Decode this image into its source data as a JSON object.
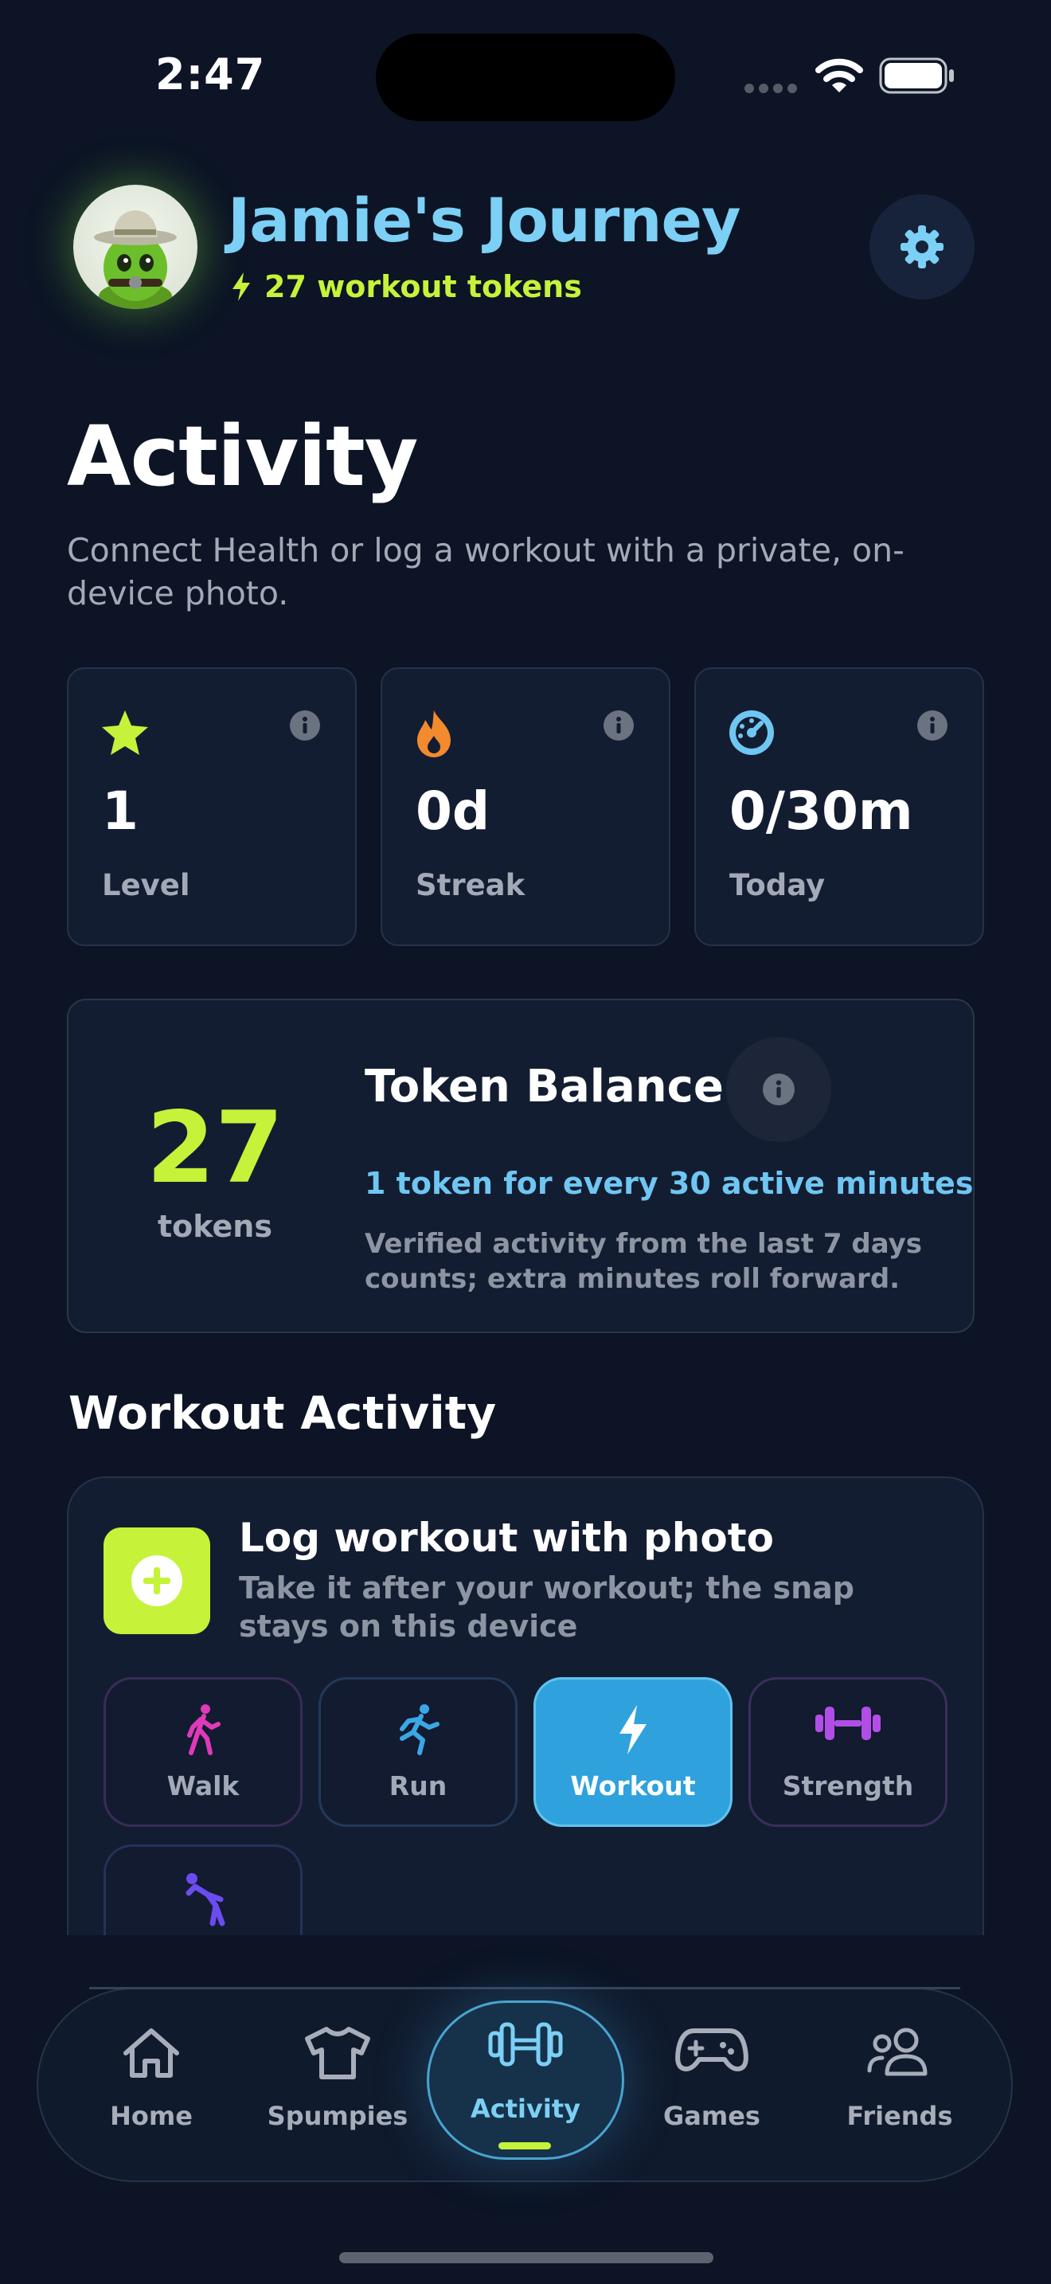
{
  "status_bar": {
    "time": "2:47"
  },
  "header": {
    "title": "Jamie's Journey",
    "tokens_label": "27 workout tokens"
  },
  "page": {
    "title": "Activity",
    "subtitle": "Connect Health or log a workout with a private, on-device photo."
  },
  "stats": [
    {
      "icon": "star-icon",
      "value": "1",
      "label": "Level",
      "color": "#c6f23a"
    },
    {
      "icon": "flame-icon",
      "value": "0d",
      "label": "Streak",
      "color": "#f28a2e"
    },
    {
      "icon": "gauge-icon",
      "value": "0/30m",
      "label": "Today",
      "color": "#6fc6f2"
    }
  ],
  "token_balance": {
    "count": "27",
    "unit": "tokens",
    "title": "Token Balance",
    "rate": "1 token for every 30 active minutes",
    "description": "Verified activity from the last 7 days counts; extra minutes roll forward."
  },
  "workout_section": {
    "title": "Workout Activity",
    "log_title": "Log workout with photo",
    "log_description": "Take it after your workout; the snap stays on this device",
    "activities": [
      {
        "label": "Walk",
        "icon": "walking-person-icon",
        "color": "#e03ab8"
      },
      {
        "label": "Run",
        "icon": "running-person-icon",
        "color": "#3aa7e6"
      },
      {
        "label": "Workout",
        "icon": "lightning-bolt-icon",
        "selected": true
      },
      {
        "label": "Strength",
        "icon": "dumbbell-icon",
        "color": "#b24ee6"
      },
      {
        "label": "",
        "icon": "stretching-person-icon",
        "color": "#6a4cf0"
      }
    ]
  },
  "tabbar": {
    "items": [
      {
        "label": "Home",
        "icon": "house-icon"
      },
      {
        "label": "Spumpies",
        "icon": "tshirt-icon"
      },
      {
        "label": "Activity",
        "icon": "dumbbell-icon",
        "active": true
      },
      {
        "label": "Games",
        "icon": "gamepad-icon"
      },
      {
        "label": "Friends",
        "icon": "people-icon"
      }
    ]
  },
  "colors": {
    "background": "#0c1425",
    "card": "#131d31",
    "accent_lime": "#c6f23a",
    "accent_blue": "#7ccff5",
    "selected_button": "#2fa2dd"
  }
}
